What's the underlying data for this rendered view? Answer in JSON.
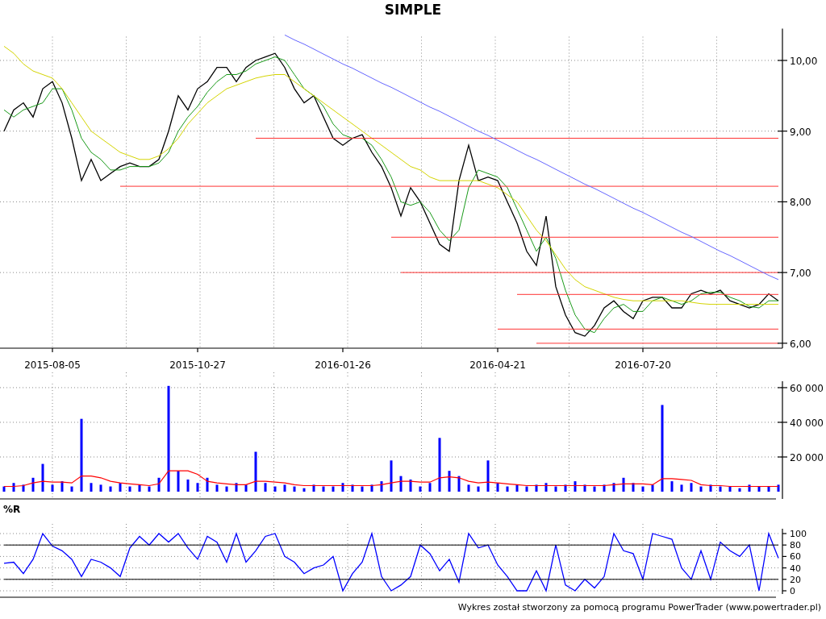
{
  "title": "SIMPLE",
  "price_panel": {
    "chart_data": {
      "type": "line",
      "categories": [
        null,
        null,
        null,
        null,
        null,
        "2015-08-05",
        null,
        null,
        null,
        null,
        null,
        null,
        null,
        null,
        null,
        null,
        null,
        null,
        null,
        null,
        "2015-10-27",
        null,
        null,
        null,
        null,
        null,
        null,
        null,
        null,
        null,
        null,
        null,
        null,
        null,
        null,
        "2016-01-26",
        null,
        null,
        null,
        null,
        null,
        null,
        null,
        null,
        null,
        null,
        null,
        null,
        null,
        null,
        null,
        "2016-04-21",
        null,
        null,
        null,
        null,
        null,
        null,
        null,
        null,
        null,
        null,
        null,
        null,
        null,
        null,
        "2016-07-20",
        null,
        null,
        null,
        null,
        null,
        null,
        null,
        null,
        null,
        null,
        null,
        null,
        null,
        null
      ],
      "ylim": [
        5.93,
        10.45
      ],
      "grid": true,
      "yticks": [
        {
          "value": 6,
          "label": "6,00"
        },
        {
          "value": 7,
          "label": "7,00"
        },
        {
          "value": 8,
          "label": "8,00"
        },
        {
          "value": 9,
          "label": "9,00"
        },
        {
          "value": 10,
          "label": "10,00"
        }
      ],
      "series": [
        {
          "color": "#000000",
          "values": [
            9.0,
            9.3,
            9.4,
            9.2,
            9.6,
            9.7,
            9.4,
            8.9,
            8.3,
            8.6,
            8.3,
            8.4,
            8.5,
            8.55,
            8.5,
            8.5,
            8.6,
            9.0,
            9.5,
            9.3,
            9.6,
            9.7,
            9.9,
            9.9,
            9.7,
            9.9,
            10.0,
            10.05,
            10.1,
            9.9,
            9.6,
            9.4,
            9.5,
            9.2,
            8.9,
            8.8,
            8.9,
            8.95,
            8.7,
            8.5,
            8.2,
            7.8,
            8.2,
            8.0,
            7.7,
            7.4,
            7.3,
            8.3,
            8.8,
            8.3,
            8.35,
            8.3,
            8.0,
            7.7,
            7.3,
            7.1,
            7.8,
            6.8,
            6.4,
            6.15,
            6.1,
            6.25,
            6.5,
            6.6,
            6.45,
            6.35,
            6.6,
            6.65,
            6.65,
            6.5,
            6.5,
            6.7,
            6.75,
            6.7,
            6.75,
            6.6,
            6.55,
            6.5,
            6.55,
            6.7,
            6.6
          ]
        },
        {
          "color": "#1a9a1a",
          "values": [
            9.3,
            9.2,
            9.3,
            9.35,
            9.4,
            9.6,
            9.6,
            9.3,
            8.9,
            8.7,
            8.6,
            8.45,
            8.45,
            8.5,
            8.5,
            8.5,
            8.55,
            8.7,
            9.0,
            9.2,
            9.35,
            9.55,
            9.7,
            9.8,
            9.8,
            9.85,
            9.95,
            10.0,
            10.05,
            10.0,
            9.8,
            9.6,
            9.5,
            9.35,
            9.1,
            8.95,
            8.9,
            8.9,
            8.8,
            8.6,
            8.35,
            8.0,
            7.95,
            8.0,
            7.85,
            7.6,
            7.45,
            7.6,
            8.2,
            8.45,
            8.4,
            8.35,
            8.2,
            7.9,
            7.6,
            7.3,
            7.5,
            7.2,
            6.75,
            6.4,
            6.2,
            6.15,
            6.35,
            6.5,
            6.55,
            6.45,
            6.45,
            6.6,
            6.65,
            6.6,
            6.55,
            6.6,
            6.7,
            6.72,
            6.72,
            6.65,
            6.6,
            6.52,
            6.5,
            6.6,
            6.6
          ]
        },
        {
          "color": "#d4d400",
          "values": [
            10.2,
            10.1,
            9.95,
            9.85,
            9.8,
            9.75,
            9.6,
            9.4,
            9.2,
            9.0,
            8.9,
            8.8,
            8.7,
            8.65,
            8.6,
            8.6,
            8.65,
            8.75,
            8.9,
            9.1,
            9.25,
            9.4,
            9.5,
            9.6,
            9.65,
            9.7,
            9.75,
            9.78,
            9.8,
            9.8,
            9.7,
            9.6,
            9.5,
            9.4,
            9.3,
            9.2,
            9.1,
            9.0,
            8.9,
            8.8,
            8.7,
            8.6,
            8.5,
            8.45,
            8.35,
            8.3,
            8.3,
            8.3,
            8.3,
            8.3,
            8.25,
            8.2,
            8.1,
            8.0,
            7.8,
            7.6,
            7.45,
            7.25,
            7.05,
            6.9,
            6.8,
            6.75,
            6.7,
            6.65,
            6.62,
            6.6,
            6.6,
            6.6,
            6.6,
            6.6,
            6.6,
            6.58,
            6.56,
            6.55,
            6.55,
            6.55,
            6.55,
            6.55,
            6.55,
            6.55,
            6.55
          ]
        },
        {
          "color": "#ff3333",
          "values": [
            null,
            null,
            null,
            null,
            null,
            null,
            null,
            null,
            null,
            null,
            null,
            null,
            null,
            null,
            null,
            null,
            null,
            null,
            null,
            null,
            null,
            null,
            null,
            null,
            null,
            null,
            8.9,
            8.9,
            8.9,
            8.9,
            8.9,
            8.9,
            8.9,
            8.9,
            8.9,
            8.9,
            8.9,
            8.9,
            8.9,
            8.9,
            8.9,
            8.9,
            8.9,
            8.9,
            8.9,
            8.9,
            8.9,
            8.9,
            8.9,
            8.9,
            8.9,
            8.9,
            8.9,
            8.9,
            8.9,
            8.9,
            8.9,
            8.9,
            8.9,
            8.9,
            8.9,
            8.9,
            8.9,
            8.9,
            8.9,
            8.9,
            8.9,
            8.9,
            8.9,
            8.9,
            8.9,
            8.9,
            8.9,
            8.9,
            8.9,
            8.9,
            8.9,
            8.9,
            8.9,
            8.9,
            8.9
          ]
        },
        {
          "color": "#ff3333",
          "values": [
            null,
            null,
            null,
            null,
            null,
            null,
            null,
            null,
            null,
            null,
            null,
            null,
            8.22,
            8.22,
            8.22,
            8.22,
            8.22,
            8.22,
            8.22,
            8.22,
            8.22,
            8.22,
            8.22,
            8.22,
            8.22,
            8.22,
            8.22,
            8.22,
            8.22,
            8.22,
            8.22,
            8.22,
            8.22,
            8.22,
            8.22,
            8.22,
            8.22,
            8.22,
            8.22,
            8.22,
            8.22,
            8.22,
            8.22,
            8.22,
            8.22,
            8.22,
            8.22,
            8.22,
            8.22,
            8.22,
            8.22,
            8.22,
            8.22,
            8.22,
            8.22,
            8.22,
            8.22,
            8.22,
            8.22,
            8.22,
            8.22,
            8.22,
            8.22,
            8.22,
            8.22,
            8.22,
            8.22,
            8.22,
            8.22,
            8.22,
            8.22,
            8.22,
            8.22,
            8.22,
            8.22,
            8.22,
            8.22,
            8.22,
            8.22,
            8.22,
            8.22
          ]
        },
        {
          "color": "#ff3333",
          "values": [
            null,
            null,
            null,
            null,
            null,
            null,
            null,
            null,
            null,
            null,
            null,
            null,
            null,
            null,
            null,
            null,
            null,
            null,
            null,
            null,
            null,
            null,
            null,
            null,
            null,
            null,
            null,
            null,
            null,
            null,
            null,
            null,
            null,
            null,
            null,
            null,
            null,
            null,
            null,
            null,
            7.5,
            7.5,
            7.5,
            7.5,
            7.5,
            7.5,
            7.5,
            7.5,
            7.5,
            7.5,
            7.5,
            7.5,
            7.5,
            7.5,
            7.5,
            7.5,
            7.5,
            7.5,
            7.5,
            7.5,
            7.5,
            7.5,
            7.5,
            7.5,
            7.5,
            7.5,
            7.5,
            7.5,
            7.5,
            7.5,
            7.5,
            7.5,
            7.5,
            7.5,
            7.5,
            7.5,
            7.5,
            7.5,
            7.5,
            7.5,
            7.5
          ]
        },
        {
          "color": "#ff3333",
          "values": [
            null,
            null,
            null,
            null,
            null,
            null,
            null,
            null,
            null,
            null,
            null,
            null,
            null,
            null,
            null,
            null,
            null,
            null,
            null,
            null,
            null,
            null,
            null,
            null,
            null,
            null,
            null,
            null,
            null,
            null,
            null,
            null,
            null,
            null,
            null,
            null,
            null,
            null,
            null,
            null,
            null,
            7.0,
            7.0,
            7.0,
            7.0,
            7.0,
            7.0,
            7.0,
            7.0,
            7.0,
            7.0,
            7.0,
            7.0,
            7.0,
            7.0,
            7.0,
            7.0,
            7.0,
            7.0,
            7.0,
            7.0,
            7.0,
            7.0,
            7.0,
            7.0,
            7.0,
            7.0,
            7.0,
            7.0,
            7.0,
            7.0,
            7.0,
            7.0,
            7.0,
            7.0,
            7.0,
            7.0,
            7.0,
            7.0,
            7.0,
            7.0
          ]
        },
        {
          "color": "#ff3333",
          "values": [
            null,
            null,
            null,
            null,
            null,
            null,
            null,
            null,
            null,
            null,
            null,
            null,
            null,
            null,
            null,
            null,
            null,
            null,
            null,
            null,
            null,
            null,
            null,
            null,
            null,
            null,
            null,
            null,
            null,
            null,
            null,
            null,
            null,
            null,
            null,
            null,
            null,
            null,
            null,
            null,
            null,
            null,
            null,
            null,
            null,
            null,
            null,
            null,
            null,
            null,
            null,
            null,
            null,
            6.69,
            6.69,
            6.69,
            6.69,
            6.69,
            6.69,
            6.69,
            6.69,
            6.69,
            6.69,
            6.69,
            6.69,
            6.69,
            6.69,
            6.69,
            6.69,
            6.69,
            6.69,
            6.69,
            6.69,
            6.69,
            6.69,
            6.69,
            6.69,
            6.69,
            6.69,
            6.69,
            6.69
          ]
        },
        {
          "color": "#ff3333",
          "values": [
            null,
            null,
            null,
            null,
            null,
            null,
            null,
            null,
            null,
            null,
            null,
            null,
            null,
            null,
            null,
            null,
            null,
            null,
            null,
            null,
            null,
            null,
            null,
            null,
            null,
            null,
            null,
            null,
            null,
            null,
            null,
            null,
            null,
            null,
            null,
            null,
            null,
            null,
            null,
            null,
            null,
            null,
            null,
            null,
            null,
            null,
            null,
            null,
            null,
            null,
            null,
            6.2,
            6.2,
            6.2,
            6.2,
            6.2,
            6.2,
            6.2,
            6.2,
            6.2,
            6.2,
            6.2,
            6.2,
            6.2,
            6.2,
            6.2,
            6.2,
            6.2,
            6.2,
            6.2,
            6.2,
            6.2,
            6.2,
            6.2,
            6.2,
            6.2,
            6.2,
            6.2,
            6.2,
            6.2,
            6.2
          ]
        },
        {
          "color": "#ff3333",
          "values": [
            null,
            null,
            null,
            null,
            null,
            null,
            null,
            null,
            null,
            null,
            null,
            null,
            null,
            null,
            null,
            null,
            null,
            null,
            null,
            null,
            null,
            null,
            null,
            null,
            null,
            null,
            null,
            null,
            null,
            null,
            null,
            null,
            null,
            null,
            null,
            null,
            null,
            null,
            null,
            null,
            null,
            null,
            null,
            null,
            null,
            null,
            null,
            null,
            null,
            null,
            null,
            null,
            null,
            null,
            null,
            6.0,
            6.0,
            6.0,
            6.0,
            6.0,
            6.0,
            6.0,
            6.0,
            6.0,
            6.0,
            6.0,
            6.0,
            6.0,
            6.0,
            6.0,
            6.0,
            6.0,
            6.0,
            6.0,
            6.0,
            6.0,
            6.0,
            6.0,
            6.0,
            6.0,
            6.0
          ]
        },
        {
          "color": "#6666ff",
          "values": [
            null,
            null,
            null,
            null,
            null,
            null,
            null,
            null,
            null,
            null,
            null,
            null,
            null,
            null,
            null,
            null,
            null,
            null,
            null,
            null,
            null,
            null,
            null,
            null,
            null,
            null,
            null,
            null,
            null,
            10.36,
            10.29,
            10.23,
            10.16,
            10.09,
            10.02,
            9.95,
            9.89,
            9.82,
            9.75,
            9.68,
            9.62,
            9.55,
            9.48,
            9.41,
            9.34,
            9.28,
            9.21,
            9.14,
            9.07,
            9.0,
            8.94,
            8.87,
            8.8,
            8.73,
            8.66,
            8.6,
            8.53,
            8.46,
            8.39,
            8.32,
            8.25,
            8.19,
            8.12,
            8.05,
            7.98,
            7.91,
            7.85,
            7.78,
            7.71,
            7.64,
            7.57,
            7.51,
            7.44,
            7.37,
            7.3,
            7.24,
            7.17,
            7.1,
            7.03,
            6.96,
            6.9
          ]
        }
      ]
    }
  },
  "volume_panel": {
    "chart_data": {
      "type": "bar",
      "categories": [
        null,
        null,
        null,
        null,
        null,
        null,
        null,
        null,
        null,
        null,
        null,
        null,
        null,
        null,
        null,
        null,
        null,
        null,
        null,
        null,
        null,
        null,
        null,
        null,
        null,
        null,
        null,
        null,
        null,
        null,
        null,
        null,
        null,
        null,
        null,
        null,
        null,
        null,
        null,
        null,
        null,
        null,
        null,
        null,
        null,
        null,
        null,
        null,
        null,
        null,
        null,
        null,
        null,
        null,
        null,
        null,
        null,
        null,
        null,
        null,
        null,
        null,
        null,
        null,
        null,
        null,
        null,
        null,
        null,
        null,
        null,
        null,
        null,
        null,
        null,
        null,
        null,
        null,
        null,
        null,
        null
      ],
      "ylim": [
        0,
        63000
      ],
      "grid": true,
      "yticks": [
        {
          "value": 20000,
          "label": "20 000"
        },
        {
          "value": 40000,
          "label": "40 000"
        },
        {
          "value": 60000,
          "label": "60 000"
        }
      ],
      "series": [
        {
          "color": "#0000ff",
          "values": [
            3000,
            5000,
            4000,
            8000,
            16000,
            4000,
            6000,
            3000,
            42000,
            5000,
            4000,
            3000,
            5000,
            3000,
            4000,
            3000,
            8000,
            61000,
            12000,
            7000,
            5000,
            8000,
            4000,
            3000,
            5000,
            4000,
            23000,
            5000,
            3000,
            4000,
            3000,
            2000,
            4000,
            3000,
            3000,
            5000,
            4000,
            3000,
            4000,
            6000,
            18000,
            9000,
            7000,
            3000,
            5000,
            31000,
            12000,
            9000,
            4000,
            3000,
            18000,
            5000,
            3000,
            4000,
            3000,
            4000,
            5000,
            3000,
            4000,
            6000,
            4000,
            3000,
            4000,
            5000,
            8000,
            5000,
            3000,
            4000,
            50000,
            6000,
            4000,
            5000,
            3000,
            4000,
            3000,
            3000,
            2000,
            4000,
            3000,
            3000,
            4000
          ]
        },
        {
          "type": "line",
          "color": "#ff0000",
          "values": [
            3000,
            3000,
            3500,
            5000,
            6000,
            5500,
            5500,
            5000,
            9000,
            9000,
            8000,
            6000,
            5000,
            4500,
            4000,
            3500,
            4500,
            12000,
            12000,
            12000,
            10000,
            6000,
            5000,
            4500,
            4000,
            4000,
            6000,
            6000,
            5500,
            5000,
            4000,
            3500,
            3500,
            3500,
            3500,
            3500,
            3500,
            3500,
            3500,
            4000,
            5000,
            6000,
            6000,
            5500,
            5500,
            8000,
            8500,
            8000,
            6000,
            5000,
            5500,
            5000,
            4500,
            4000,
            3500,
            3500,
            3500,
            3500,
            3500,
            3500,
            3500,
            3500,
            3500,
            4000,
            4500,
            4500,
            4500,
            4000,
            7500,
            7500,
            7000,
            6500,
            4000,
            3500,
            3500,
            3000,
            3000,
            3000,
            3000,
            3000,
            3000
          ]
        }
      ]
    }
  },
  "williams_r_panel": {
    "label": "%R",
    "chart_data": {
      "type": "line",
      "categories": [
        null,
        null,
        null,
        null,
        null,
        null,
        null,
        null,
        null,
        null,
        null,
        null,
        null,
        null,
        null,
        null,
        null,
        null,
        null,
        null,
        null,
        null,
        null,
        null,
        null,
        null,
        null,
        null,
        null,
        null,
        null,
        null,
        null,
        null,
        null,
        null,
        null,
        null,
        null,
        null,
        null,
        null,
        null,
        null,
        null,
        null,
        null,
        null,
        null,
        null,
        null,
        null,
        null,
        null,
        null,
        null,
        null,
        null,
        null,
        null,
        null,
        null,
        null,
        null,
        null,
        null,
        null,
        null,
        null,
        null,
        null,
        null,
        null,
        null,
        null,
        null,
        null,
        null,
        null,
        null,
        null
      ],
      "ylim": [
        0,
        100
      ],
      "grid": true,
      "yticks": [
        0,
        20,
        40,
        60,
        80,
        100
      ],
      "series": [
        {
          "color": "#0000ff",
          "values": [
            48,
            50,
            30,
            55,
            100,
            78,
            70,
            55,
            25,
            55,
            50,
            40,
            25,
            75,
            95,
            80,
            100,
            85,
            100,
            75,
            55,
            95,
            85,
            50,
            100,
            50,
            70,
            95,
            100,
            60,
            50,
            30,
            40,
            45,
            60,
            0,
            30,
            50,
            100,
            25,
            0,
            10,
            25,
            80,
            65,
            35,
            55,
            15,
            100,
            75,
            80,
            45,
            25,
            0,
            0,
            35,
            0,
            80,
            10,
            0,
            20,
            5,
            25,
            100,
            70,
            65,
            20,
            100,
            95,
            90,
            40,
            20,
            70,
            20,
            85,
            70,
            60,
            80,
            0,
            100,
            57
          ]
        },
        {
          "color": "#000000",
          "values": [
            80,
            80,
            80,
            80,
            80,
            80,
            80,
            80,
            80,
            80,
            80,
            80,
            80,
            80,
            80,
            80,
            80,
            80,
            80,
            80,
            80,
            80,
            80,
            80,
            80,
            80,
            80,
            80,
            80,
            80,
            80,
            80,
            80,
            80,
            80,
            80,
            80,
            80,
            80,
            80,
            80,
            80,
            80,
            80,
            80,
            80,
            80,
            80,
            80,
            80,
            80,
            80,
            80,
            80,
            80,
            80,
            80,
            80,
            80,
            80,
            80,
            80,
            80,
            80,
            80,
            80,
            80,
            80,
            80,
            80,
            80,
            80,
            80,
            80,
            80,
            80,
            80,
            80,
            80,
            80,
            80
          ]
        },
        {
          "color": "#000000",
          "values": [
            20,
            20,
            20,
            20,
            20,
            20,
            20,
            20,
            20,
            20,
            20,
            20,
            20,
            20,
            20,
            20,
            20,
            20,
            20,
            20,
            20,
            20,
            20,
            20,
            20,
            20,
            20,
            20,
            20,
            20,
            20,
            20,
            20,
            20,
            20,
            20,
            20,
            20,
            20,
            20,
            20,
            20,
            20,
            20,
            20,
            20,
            20,
            20,
            20,
            20,
            20,
            20,
            20,
            20,
            20,
            20,
            20,
            20,
            20,
            20,
            20,
            20,
            20,
            20,
            20,
            20,
            20,
            20,
            20,
            20,
            20,
            20,
            20,
            20,
            20,
            20,
            20,
            20,
            20,
            20,
            20
          ]
        }
      ]
    }
  },
  "footer": "Wykres został stworzony za pomocą programu PowerTrader (www.powertrader.pl)"
}
